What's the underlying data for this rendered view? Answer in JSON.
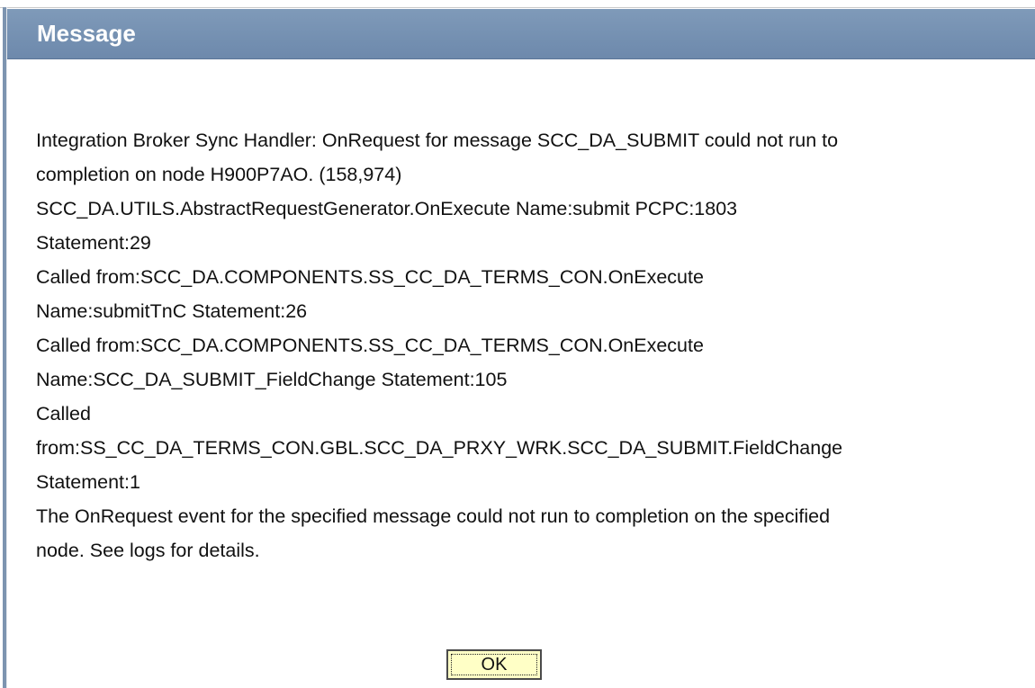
{
  "dialog": {
    "title": "Message",
    "message_lines": [
      "Integration Broker Sync Handler: OnRequest for message SCC_DA_SUBMIT could not run to",
      "completion on node H900P7AO. (158,974)",
      "SCC_DA.UTILS.AbstractRequestGenerator.OnExecute  Name:submit  PCPC:1803",
      "Statement:29",
      "Called from:SCC_DA.COMPONENTS.SS_CC_DA_TERMS_CON.OnExecute",
      "Name:submitTnC  Statement:26",
      "Called from:SCC_DA.COMPONENTS.SS_CC_DA_TERMS_CON.OnExecute",
      "Name:SCC_DA_SUBMIT_FieldChange  Statement:105",
      "Called",
      "from:SS_CC_DA_TERMS_CON.GBL.SCC_DA_PRXY_WRK.SCC_DA_SUBMIT.FieldChange",
      "Statement:1"
    ],
    "detail_lines": [
      "The OnRequest event for the specified message could not run to completion on the specified",
      "node.  See logs for details."
    ],
    "ok_label": "OK"
  },
  "colors": {
    "title_bar": "#7f9ab9",
    "title_text": "#ffffff",
    "button_background": "#ffffc6",
    "text": "#111111"
  }
}
